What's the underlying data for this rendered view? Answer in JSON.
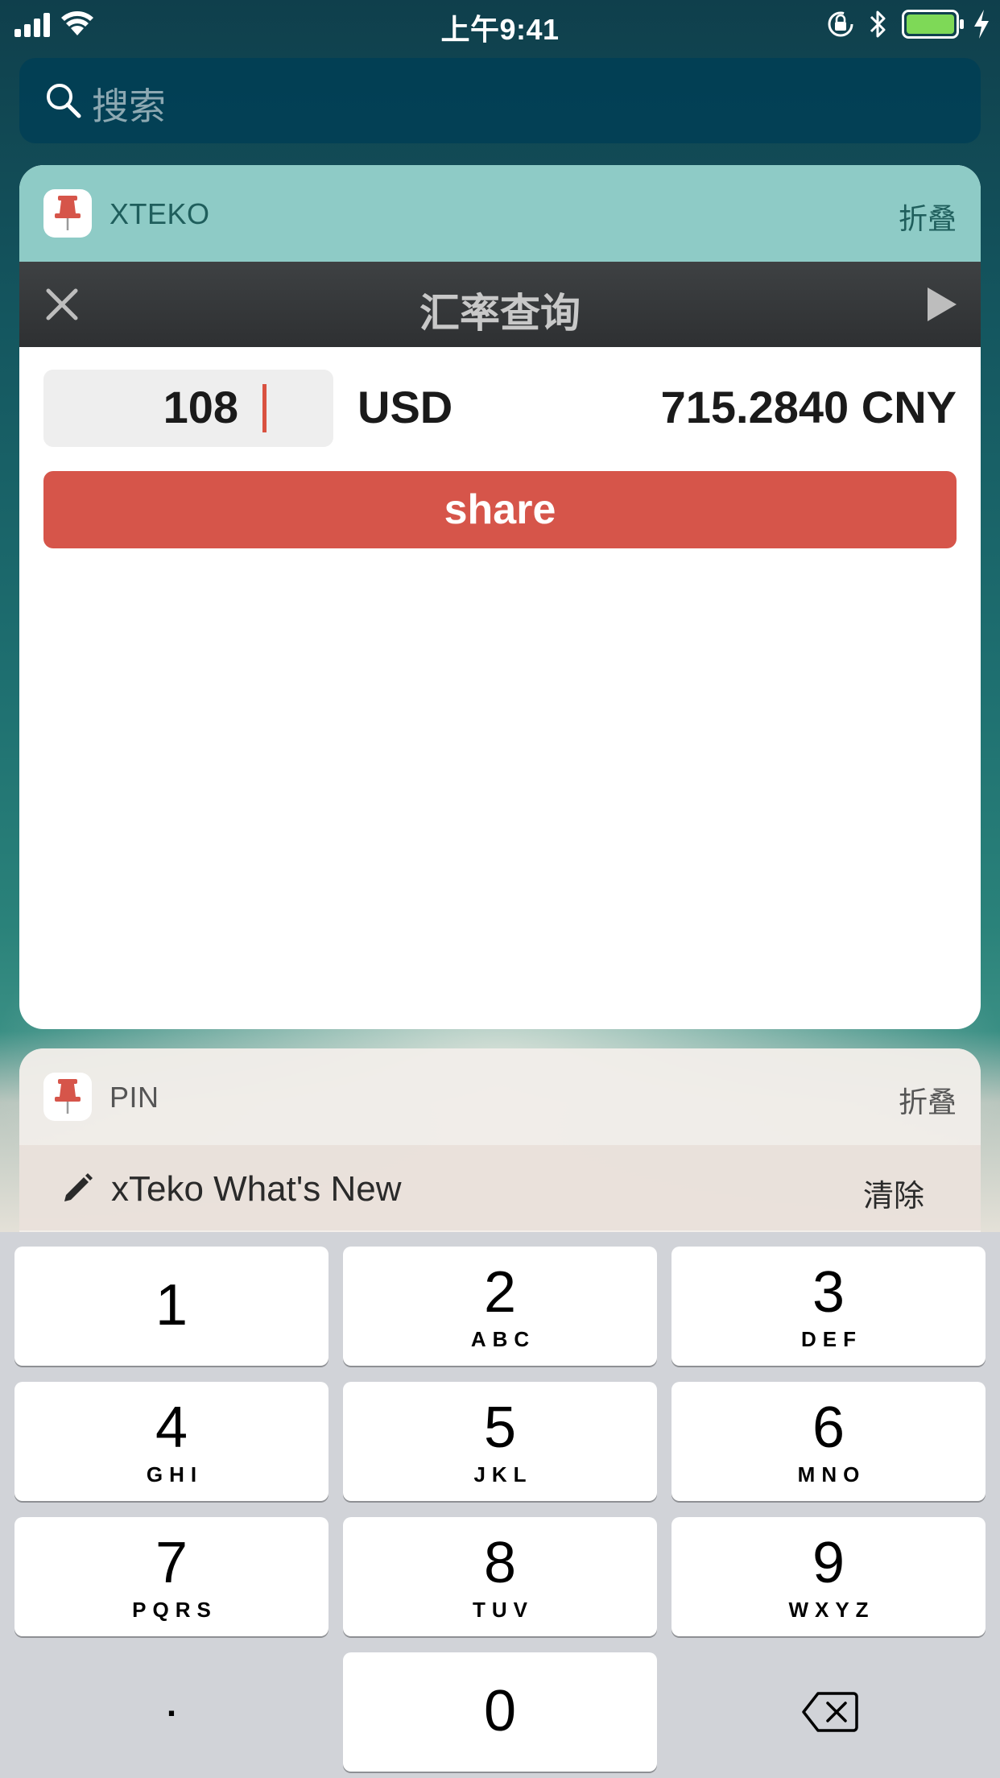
{
  "status_bar": {
    "time": "上午9:41",
    "icons": [
      "signal-icon",
      "wifi-icon",
      "lock-rotation-icon",
      "bluetooth-icon",
      "battery-icon",
      "charging-icon"
    ],
    "battery_color": "#7ed957"
  },
  "search": {
    "placeholder": "搜索",
    "icon": "search-icon"
  },
  "widget_xteko": {
    "title": "XTEKO",
    "collapse_label": "折叠",
    "header_color": "#8ecbc6",
    "toolbar": {
      "title": "汇率查询",
      "left_icon": "close-icon",
      "right_icon": "play-icon"
    },
    "amount_value": "108",
    "currency_from": "USD",
    "converted_value": "715.2840 CNY",
    "share_label": "share",
    "share_color": "#d6554a"
  },
  "widget_pin": {
    "title": "PIN",
    "collapse_label": "折叠",
    "row": {
      "icon": "pencil-icon",
      "title": "xTeko What's New",
      "action_label": "清除"
    }
  },
  "keypad": {
    "keys": [
      {
        "digit": "1",
        "letters": ""
      },
      {
        "digit": "2",
        "letters": "ABC"
      },
      {
        "digit": "3",
        "letters": "DEF"
      },
      {
        "digit": "4",
        "letters": "GHI"
      },
      {
        "digit": "5",
        "letters": "JKL"
      },
      {
        "digit": "6",
        "letters": "MNO"
      },
      {
        "digit": "7",
        "letters": "PQRS"
      },
      {
        "digit": "8",
        "letters": "TUV"
      },
      {
        "digit": "9",
        "letters": "WXYZ"
      },
      {
        "digit": "0",
        "letters": ""
      }
    ],
    "dot_label": ".",
    "backspace_icon": "backspace-icon"
  }
}
